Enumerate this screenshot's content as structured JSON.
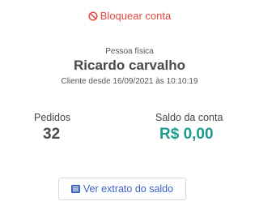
{
  "actions": {
    "block_label": "Bloquear conta",
    "statement_label": "Ver extrato do saldo"
  },
  "customer": {
    "type": "Pessoa física",
    "name": "Ricardo carvalho",
    "since": "Cliente desde 16/09/2021 às 10:10:19"
  },
  "stats": {
    "orders_label": "Pedidos",
    "orders_value": "32",
    "balance_label": "Saldo da conta",
    "balance_value": "R$ 0,00"
  },
  "icons": {
    "block": "ban-icon",
    "statement": "list-icon"
  },
  "colors": {
    "danger": "#e0483e",
    "balance": "#1f9b8c",
    "link": "#3a63c8"
  }
}
